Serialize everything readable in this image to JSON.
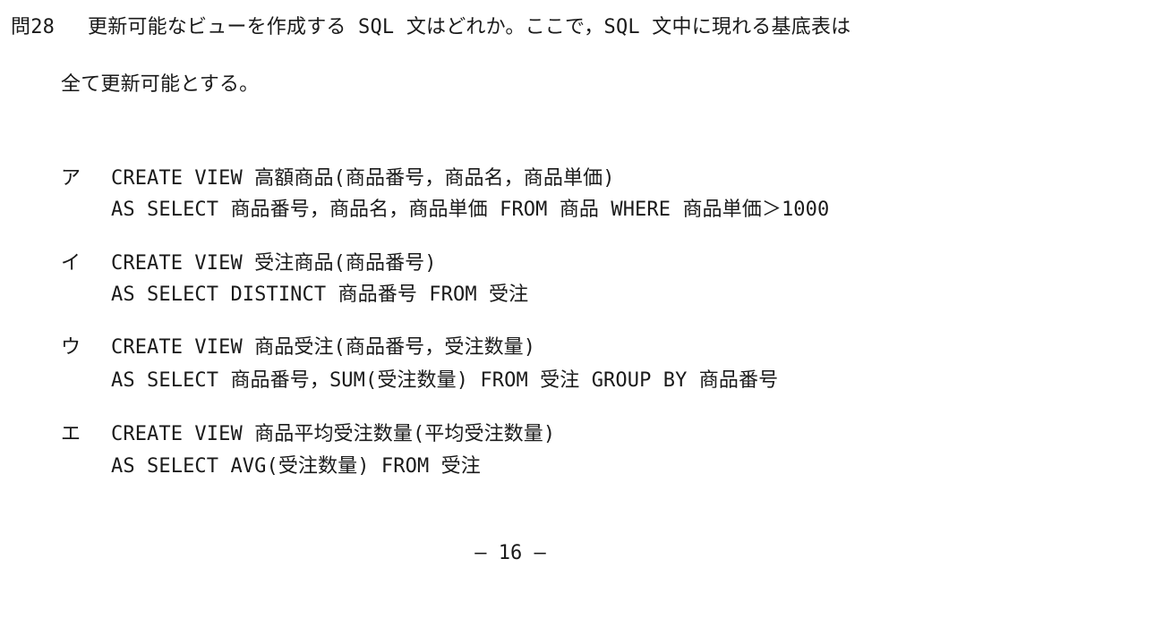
{
  "question": {
    "number": "問28",
    "text_line1": "更新可能なビューを作成する SQL 文はどれか。ここで，SQL 文中に現れる基底表は",
    "text_line2": "全て更新可能とする。"
  },
  "choices": [
    {
      "label": "ア",
      "line1": "CREATE VIEW 高額商品(商品番号，商品名，商品単価)",
      "line2": "AS SELECT 商品番号，商品名，商品単価 FROM 商品 WHERE 商品単価＞1000"
    },
    {
      "label": "イ",
      "line1": "CREATE VIEW 受注商品(商品番号)",
      "line2": "AS SELECT DISTINCT 商品番号 FROM 受注"
    },
    {
      "label": "ウ",
      "line1": "CREATE VIEW 商品受注(商品番号，受注数量)",
      "line2": "AS SELECT 商品番号，SUM(受注数量) FROM 受注 GROUP BY 商品番号"
    },
    {
      "label": "エ",
      "line1": "CREATE VIEW 商品平均受注数量(平均受注数量)",
      "line2": "AS SELECT AVG(受注数量) FROM 受注"
    }
  ],
  "footer": {
    "page_number": "― 16 ―"
  }
}
